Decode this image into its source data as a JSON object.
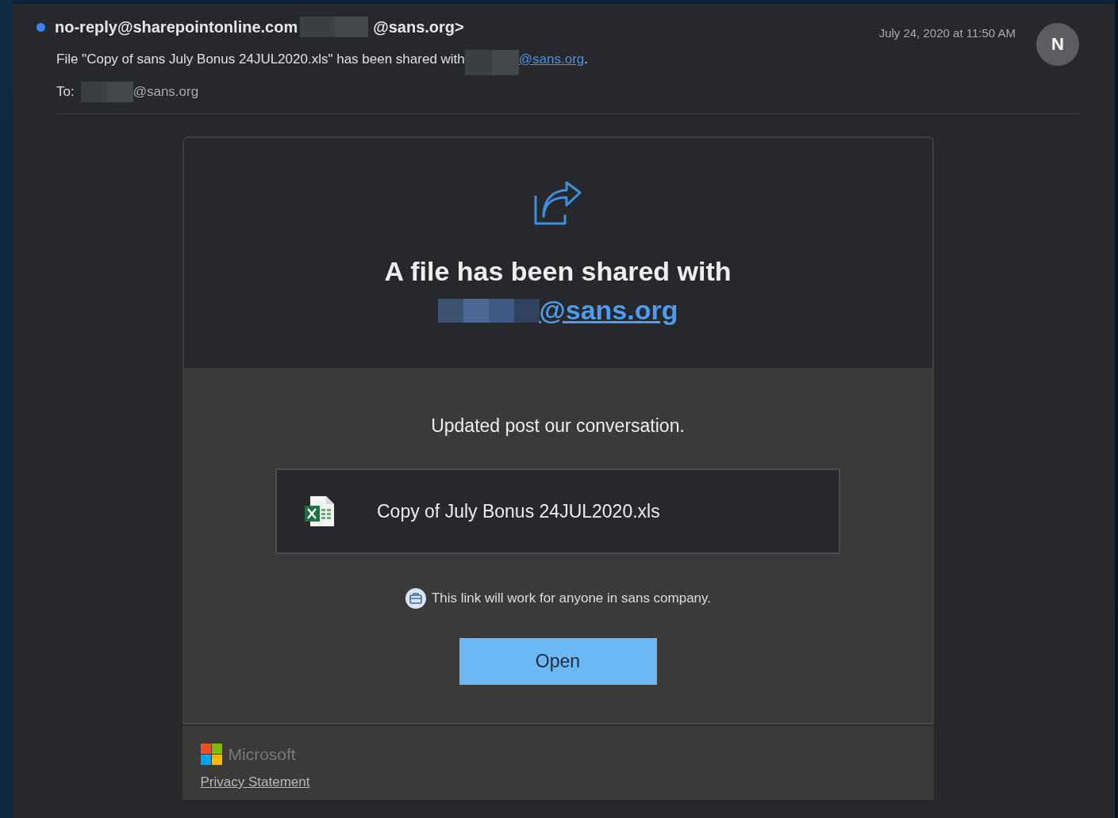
{
  "header": {
    "unread": true,
    "sender": "no-reply@sharepointonline.com",
    "sender_suffix": "@sans.org>",
    "subject_prefix": "File \"Copy of sans July Bonus 24JUL2020.xls\" has been shared with",
    "subject_link": "@sans.org",
    "subject_end": ".",
    "to_label": "To:",
    "to_suffix": "@sans.org",
    "date": "July 24, 2020 at 11:50 AM",
    "avatar": "N"
  },
  "card": {
    "heading": "A file has been shared with",
    "heading_link": "@sans.org",
    "message": "Updated post our conversation.",
    "file_name": "Copy of July Bonus 24JUL2020.xls",
    "notice": "This link will work for anyone in sans company.",
    "open_button": "Open"
  },
  "footer": {
    "brand": "Microsoft",
    "privacy": "Privacy Statement"
  }
}
